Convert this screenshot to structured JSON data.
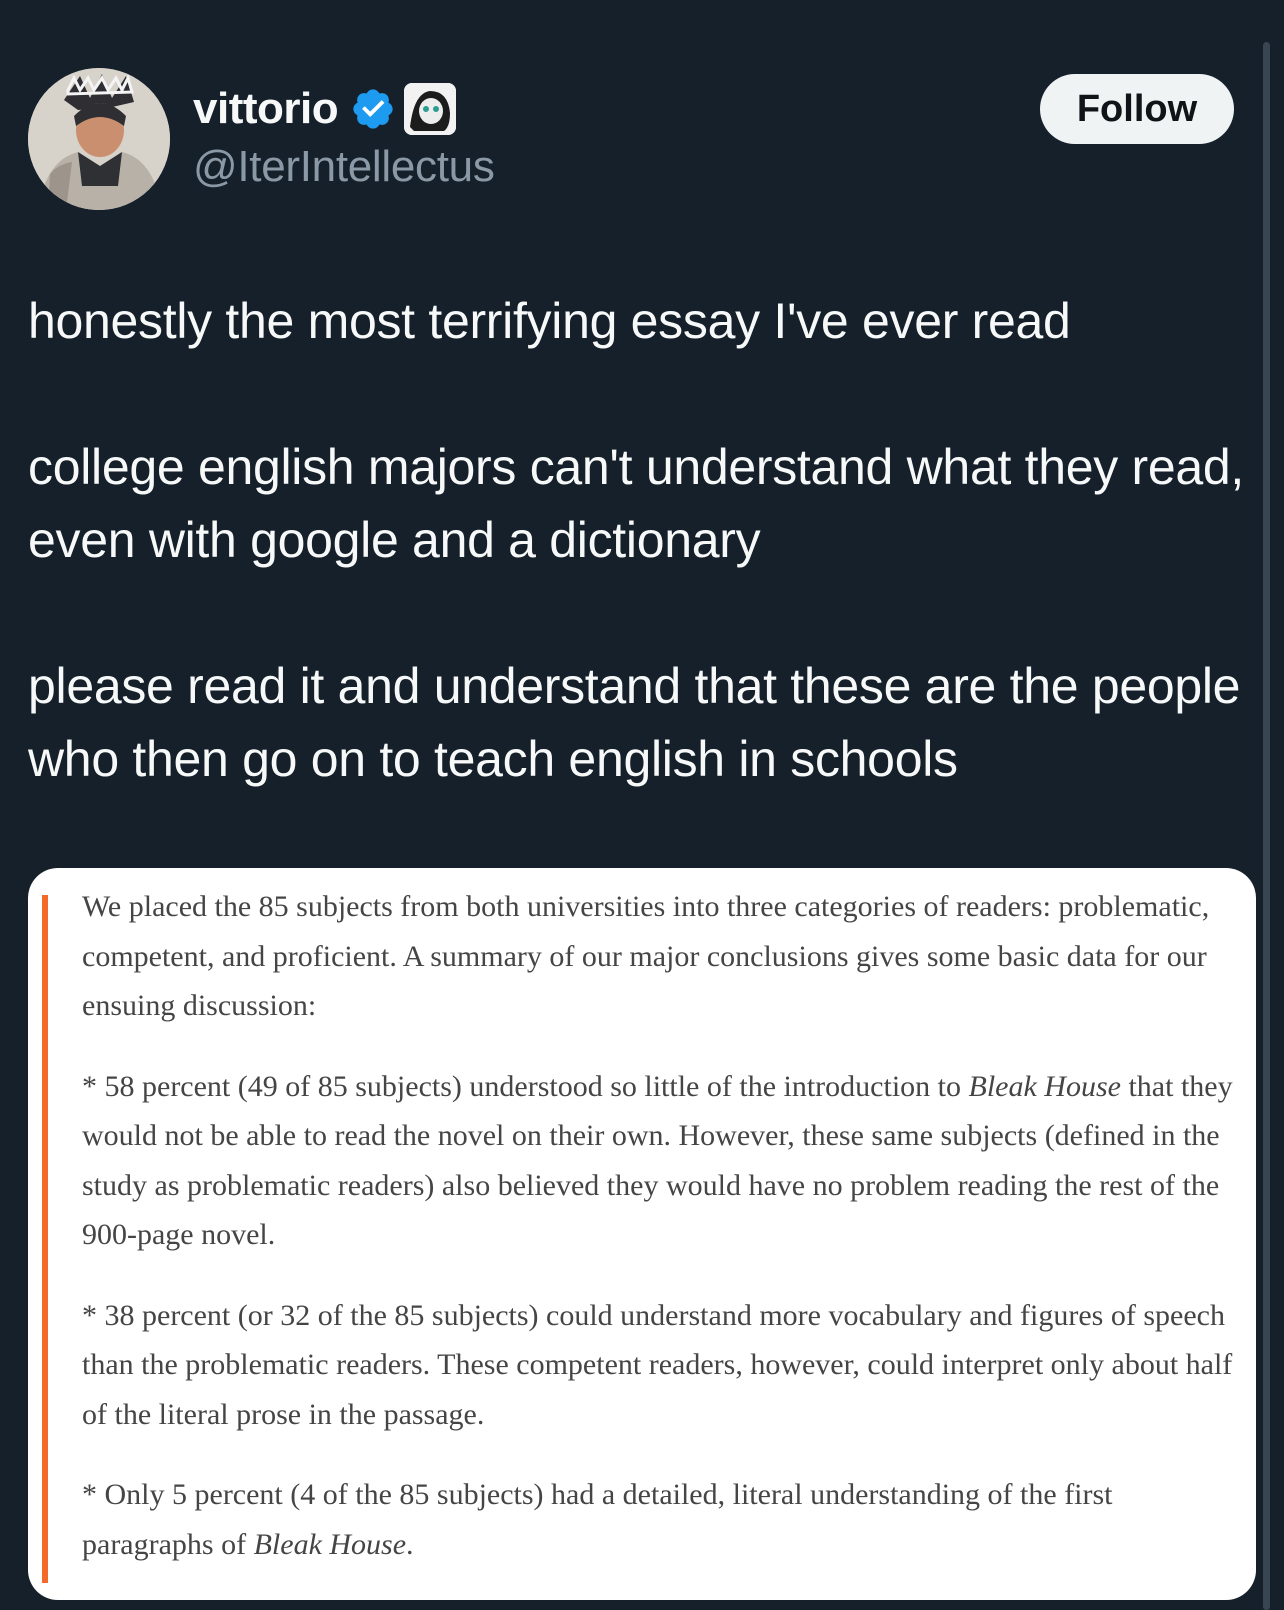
{
  "author": {
    "display_name": "vittorio",
    "handle": "@IterIntellectus",
    "avatar_icon": "anime-avatar-icon",
    "verified_icon": "verified-badge-icon",
    "affiliate_icon": "affiliate-badge-icon",
    "verified_color": "#1d9bf0"
  },
  "follow_button": {
    "label": "Follow"
  },
  "tweet": {
    "paragraphs": [
      "honestly the most terrifying essay I've ever read",
      "college english majors can't understand what they read, even with google and a dictionary",
      "please read it and understand that these are the people who then go on to teach english in schools"
    ]
  },
  "quote_card": {
    "accent_color": "#f26b2a",
    "intro": "We placed the 85 subjects from both universities into three categories of readers: problematic, competent, and proficient. A summary of our major conclusions gives some basic data for our ensuing discussion:",
    "bullet1": {
      "pre": "* 58 percent (49 of 85 subjects) understood so little of the introduction to ",
      "em": "Bleak House",
      "post": " that they would not be able to read the novel on their own. However, these same subjects (defined in the study as problematic readers) also believed they would have no problem reading the rest of the 900-page novel."
    },
    "bullet2": "* 38 percent (or 32 of the 85 subjects) could understand more vocabulary and figures of speech than the problematic readers. These competent readers, however, could interpret only about half of the literal prose in the passage.",
    "bullet3": {
      "pre": "* Only 5 percent (4 of the 85 subjects) had a detailed, literal understanding of the first paragraphs of ",
      "em": "Bleak House",
      "post": "."
    }
  }
}
